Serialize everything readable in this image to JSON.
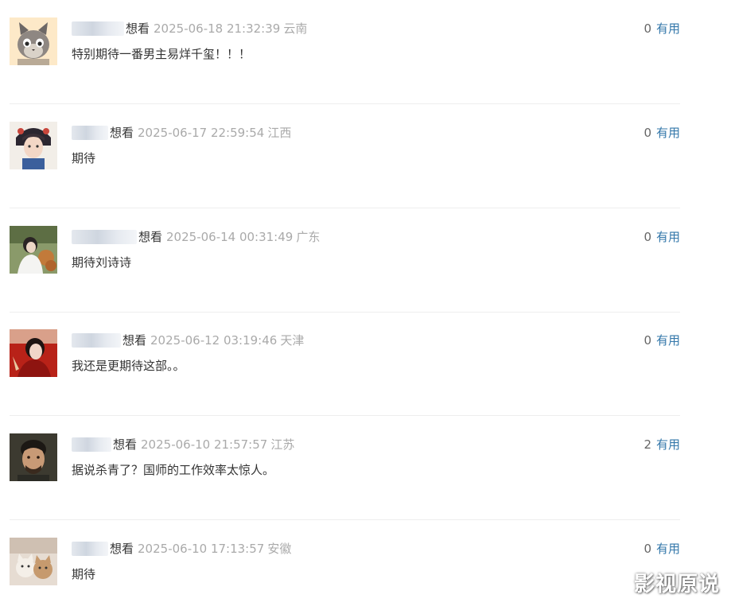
{
  "comments": [
    {
      "rating": "想看",
      "time": "2025-06-18 21:32:39",
      "region": "云南",
      "content": "特别期待一番男主易烊千玺！！！",
      "votes": "0",
      "vote_label": "有用"
    },
    {
      "rating": "想看",
      "time": "2025-06-17 22:59:54",
      "region": "江西",
      "content": "期待",
      "votes": "0",
      "vote_label": "有用"
    },
    {
      "rating": "想看",
      "time": "2025-06-14 00:31:49",
      "region": "广东",
      "content": "期待刘诗诗",
      "votes": "0",
      "vote_label": "有用"
    },
    {
      "rating": "想看",
      "time": "2025-06-12 03:19:46",
      "region": "天津",
      "content": "我还是更期待这部。。",
      "votes": "0",
      "vote_label": "有用"
    },
    {
      "rating": "想看",
      "time": "2025-06-10 21:57:57",
      "region": "江苏",
      "content": "据说杀青了？国师的工作效率太惊人。",
      "votes": "2",
      "vote_label": "有用"
    },
    {
      "rating": "想看",
      "time": "2025-06-10 17:13:57",
      "region": "安徽",
      "content": "期待",
      "votes": "0",
      "vote_label": "有用"
    }
  ],
  "watermark": "影视原说",
  "colors": {
    "link": "#3377aa",
    "meta_gray": "#aaaaaa",
    "text": "#333333",
    "divider": "#eeeeee"
  }
}
